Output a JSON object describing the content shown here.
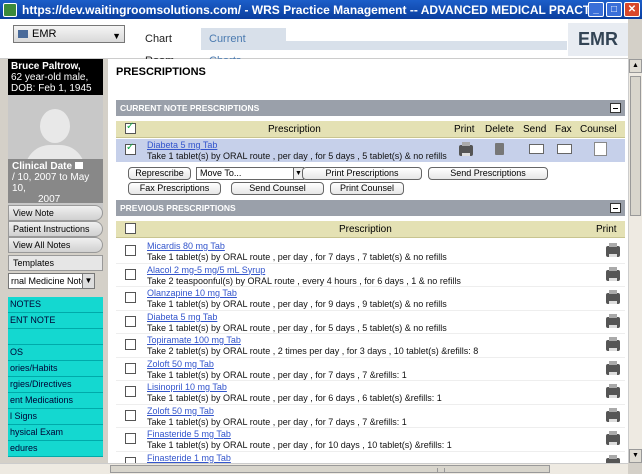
{
  "window": {
    "title": "https://dev.waitingroomsolutions.com/ - WRS Practice Management -- ADVANCED MEDICAL PRACTICE, P - Wind...",
    "minimize": "_",
    "maximize": "□",
    "close": "✕"
  },
  "topbar": {
    "emr_select": "EMR",
    "tabs": [
      "Chart Room",
      "Current Charts"
    ],
    "logo": "EMR"
  },
  "patient": {
    "name": "Bruce Paltrow,",
    "age_sex": "62 year-old male,",
    "dob": "DOB: Feb 1, 1945"
  },
  "clinical_date": {
    "label": "Clinical Date",
    "range_line1": "/ 10, 2007 to May 10,",
    "range_line2": "2007"
  },
  "sidebar": {
    "buttons": [
      "View Note",
      "Patient Instructions",
      "View All Notes",
      "Templates"
    ],
    "note_select": "rnal Medicine Note",
    "note_items": [
      "NOTES",
      "ENT NOTE",
      "",
      "OS",
      "ories/Habits",
      "rgies/Directives",
      "ent Medications",
      "l Signs",
      "hysical Exam",
      "edures"
    ]
  },
  "main": {
    "page_title": "PRESCRIPTIONS",
    "current_section": "CURRENT NOTE PRESCRIPTIONS",
    "previous_section": "PREVIOUS PRESCRIPTIONS",
    "current_headers": {
      "prescription": "Prescription",
      "print": "Print",
      "delete": "Delete",
      "send": "Send",
      "fax": "Fax",
      "counsel": "Counsel"
    },
    "current_row": {
      "name": "Diabeta 5 mg Tab",
      "desc": "Take 1 tablet(s) by ORAL route , per day , for 5 days , 5 tablet(s) & no refills"
    },
    "actions": {
      "represcribe": "Represcribe",
      "move_to": "Move To...",
      "print_prescriptions": "Print Prescriptions",
      "send_prescriptions": "Send Prescriptions",
      "fax_prescriptions": "Fax Prescriptions",
      "send_counsel": "Send Counsel",
      "print_counsel": "Print Counsel"
    },
    "previous_headers": {
      "prescription": "Prescription",
      "print": "Print"
    },
    "previous_rows": [
      {
        "name": "Micardis 80 mg Tab",
        "desc": "Take 1 tablet(s) by ORAL route , per day , for 7 days , 7 tablet(s) & no refills"
      },
      {
        "name": "Alacol 2 mg-5 mg/5 mL Syrup",
        "desc": "Take 2 teaspoonful(s) by ORAL route , every 4 hours , for 6 days , 1 & no refills"
      },
      {
        "name": "Olanzapine 10 mg Tab",
        "desc": "Take 1 tablet(s) by ORAL route , per day , for 9 days , 9 tablet(s) & no refills"
      },
      {
        "name": "Diabeta 5 mg Tab",
        "desc": "Take 1 tablet(s) by ORAL route , per day , for 5 days , 5 tablet(s) & no refills"
      },
      {
        "name": "Topiramate 100 mg Tab",
        "desc": "Take 2 tablet(s) by ORAL route , 2 times per day , for 3 days , 10 tablet(s) &refills: 8"
      },
      {
        "name": "Zoloft 50 mg Tab",
        "desc": "Take 1 tablet(s) by ORAL route , per day , for 7 days , 7 &refills: 1"
      },
      {
        "name": "Lisinopril 10 mg Tab",
        "desc": "Take 1 tablet(s) by ORAL route , per day , for 6 days , 6 tablet(s) &refills: 1"
      },
      {
        "name": "Zoloft 50 mg Tab",
        "desc": "Take 1 tablet(s) by ORAL route , per day , for 7 days , 7 &refills: 1"
      },
      {
        "name": "Finasteride 5 mg Tab",
        "desc": "Take 1 tablet(s) by ORAL route , per day , for 10 days , 10 tablet(s) &refills: 1"
      },
      {
        "name": "Finasteride 1 mg Tab",
        "desc": ""
      }
    ]
  }
}
